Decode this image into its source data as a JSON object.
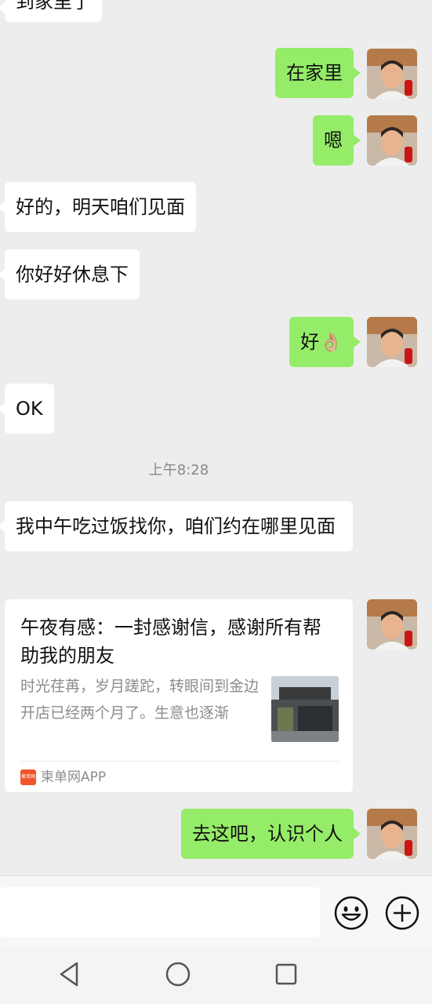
{
  "messages": [
    {
      "side": "in",
      "text": "到家里了"
    },
    {
      "side": "out",
      "text": "在家里"
    },
    {
      "side": "out",
      "text": "嗯"
    },
    {
      "side": "in",
      "text": "好的，明天咱们见面"
    },
    {
      "side": "in",
      "text": "你好好休息下"
    },
    {
      "side": "out",
      "text": "好👌🏼"
    },
    {
      "side": "in",
      "text": "OK"
    },
    {
      "side": "in",
      "text": "我中午吃过饭找你，咱们约在哪里见面"
    },
    {
      "side": "out",
      "text": "去这吧，认识个人"
    }
  ],
  "timestamp": "上午8:28",
  "card": {
    "title": "午夜有感：一封感谢信，感谢所有帮助我的朋友",
    "description": "时光荏苒，岁月蹉跎，转眼间到金边开店已经两个月了。生意也逐渐",
    "source": "柬单网APP",
    "source_logo_text": "柬单网"
  },
  "input": {
    "placeholder": ""
  },
  "icons": {
    "emoji": "smiley-face-icon",
    "plus": "plus-circle-icon",
    "back": "triangle-back-icon",
    "home": "circle-home-icon",
    "recent": "square-recent-icon"
  },
  "colors": {
    "outgoing_bubble": "#95ec69",
    "incoming_bubble": "#ffffff",
    "background": "#ededed"
  }
}
